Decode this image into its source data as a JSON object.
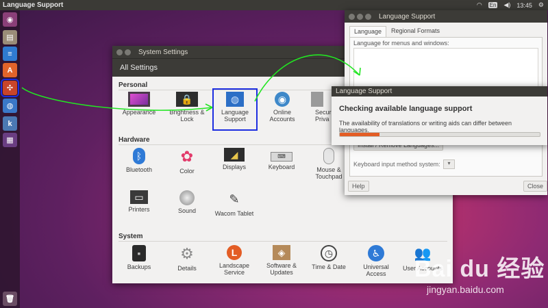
{
  "top_panel": {
    "title": "Language Support",
    "keyboard": "En",
    "time": "13:45"
  },
  "launcher": {
    "items": [
      {
        "name": "dash-icon"
      },
      {
        "name": "file-manager-icon"
      },
      {
        "name": "writer-icon"
      },
      {
        "name": "software-center-icon"
      },
      {
        "name": "system-settings-icon"
      },
      {
        "name": "language-support-icon"
      },
      {
        "name": "kdevelop-icon"
      },
      {
        "name": "workspace-switcher-icon"
      },
      {
        "name": "trash-icon"
      }
    ]
  },
  "system_settings": {
    "title": "System Settings",
    "toolbar_label": "All Settings",
    "sections": [
      {
        "heading": "Personal",
        "items": [
          {
            "label1": "Appearance",
            "label2": ""
          },
          {
            "label1": "Brightness &",
            "label2": "Lock"
          },
          {
            "label1": "Language",
            "label2": "Support"
          },
          {
            "label1": "Online",
            "label2": "Accounts"
          },
          {
            "label1": "Securi",
            "label2": "Priva"
          }
        ]
      },
      {
        "heading": "Hardware",
        "items": [
          {
            "label1": "Bluetooth",
            "label2": ""
          },
          {
            "label1": "Color",
            "label2": ""
          },
          {
            "label1": "Displays",
            "label2": ""
          },
          {
            "label1": "Keyboard",
            "label2": ""
          },
          {
            "label1": "Mouse &",
            "label2": "Touchpad"
          },
          {
            "label1": "Printers",
            "label2": ""
          },
          {
            "label1": "Sound",
            "label2": ""
          },
          {
            "label1": "Wacom Tablet",
            "label2": ""
          }
        ]
      },
      {
        "heading": "System",
        "items": [
          {
            "label1": "Backups",
            "label2": ""
          },
          {
            "label1": "Details",
            "label2": ""
          },
          {
            "label1": "Landscape",
            "label2": "Service"
          },
          {
            "label1": "Software &",
            "label2": "Updates"
          },
          {
            "label1": "Time & Date",
            "label2": ""
          },
          {
            "label1": "Universal",
            "label2": "Access"
          },
          {
            "label1": "User Accounts",
            "label2": ""
          }
        ]
      }
    ]
  },
  "language_support": {
    "title": "Language Support",
    "tabs": [
      "Language",
      "Regional Formats"
    ],
    "list_label": "Language for menus and windows:",
    "install_button": "Install / Remove Languages...",
    "input_method_label": "Keyboard input method system:",
    "help_button": "Help",
    "close_button": "Close"
  },
  "dialog": {
    "title": "Language Support",
    "heading": "Checking available language support",
    "text": "The availability of translations or writing aids can differ between languages.",
    "progress": 0.2
  },
  "watermark": {
    "logo": "Bai du 经验",
    "url": "jingyan.baidu.com"
  },
  "colors": {
    "highlight": "#1d2de0",
    "arrow": "#22e622",
    "progress": "#e35d25"
  }
}
